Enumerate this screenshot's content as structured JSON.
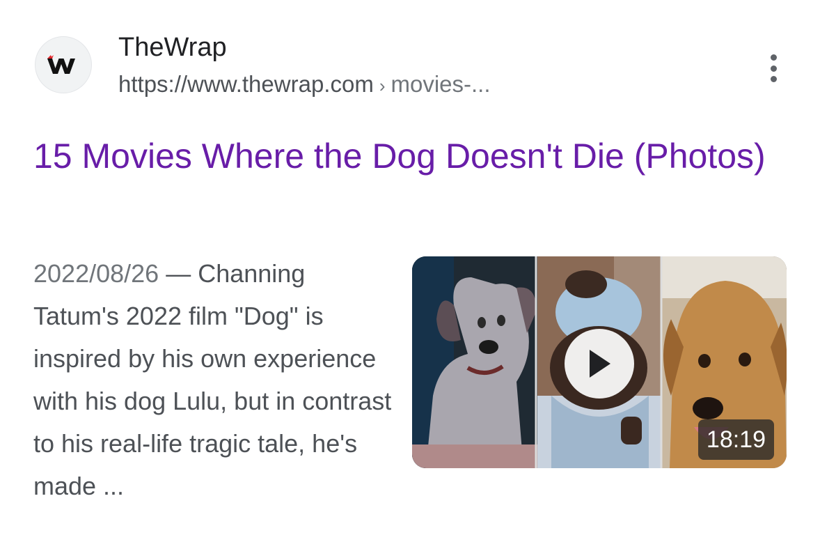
{
  "result": {
    "site_name": "TheWrap",
    "url_domain": "https://www.thewrap.com",
    "url_separator": "›",
    "url_path": "movies-...",
    "favicon_icon": "thewrap-logo-icon",
    "more_icon": "more-vert-icon",
    "title": "15 Movies Where the Dog Doesn't Die (Photos)",
    "date": "2022/08/26",
    "dash": " — ",
    "snippet": "Channing Tatum's 2022 film \"Dog\" is inspired by his own experience with his dog Lulu, but in contrast to his real-life tragic tale, he's made ...",
    "video": {
      "duration": "18:19",
      "play_icon": "play-icon"
    }
  },
  "colors": {
    "title_visited": "#681da8",
    "site_name": "#202124",
    "snippet": "#4d5156",
    "logo_red": "#e0262b"
  }
}
